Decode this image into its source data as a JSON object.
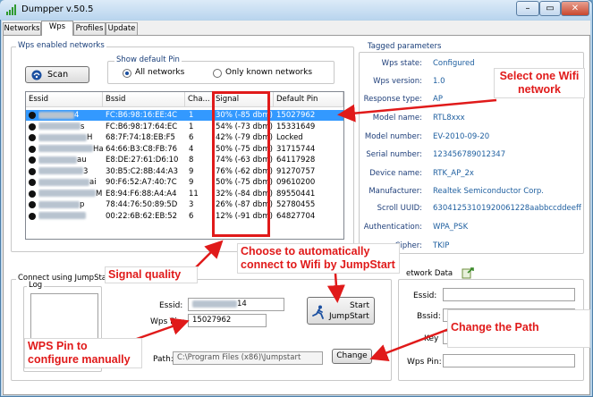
{
  "window": {
    "title": "Dumpper v.50.5",
    "controls": {
      "minimize": "–",
      "maximize": "▭",
      "close": "✕"
    }
  },
  "tabs": [
    {
      "label": "Networks"
    },
    {
      "label": "Wps"
    },
    {
      "label": "Profiles"
    },
    {
      "label": "Update"
    }
  ],
  "wps_networks": {
    "group_title": "Wps enabled networks",
    "scan_label": "Scan",
    "default_pin": {
      "title": "Show default Pin",
      "all_label": "All networks",
      "known_label": "Only known networks",
      "selected": "all"
    },
    "columns": [
      "Essid",
      "Bssid",
      "Cha...",
      "Signal",
      "Default Pin"
    ],
    "rows": [
      {
        "essid": "4",
        "bssid": "FC:B6:98:16:EE:4C",
        "channel": "1",
        "signal": "30% (-85 dbm)",
        "pin": "15027962",
        "selected": true
      },
      {
        "essid": "s",
        "bssid": "FC:B6:98:17:64:EC",
        "channel": "1",
        "signal": "54% (-73 dbm)",
        "pin": "15331649"
      },
      {
        "essid": "H",
        "bssid": "68:7F:74:18:EB:F5",
        "channel": "6",
        "signal": "42% (-79 dbm)",
        "pin": "Locked"
      },
      {
        "essid": "Ha",
        "bssid": "64:66:B3:C8:FB:76",
        "channel": "4",
        "signal": "50% (-75 dbm)",
        "pin": "31715744"
      },
      {
        "essid": "au",
        "bssid": "E8:DE:27:61:D6:10",
        "channel": "8",
        "signal": "74% (-63 dbm)",
        "pin": "64117928"
      },
      {
        "essid": "3",
        "bssid": "30:B5:C2:8B:44:A3",
        "channel": "9",
        "signal": "76% (-62 dbm)",
        "pin": "91270757"
      },
      {
        "essid": "ai",
        "bssid": "90:F6:52:A7:40:7C",
        "channel": "9",
        "signal": "50% (-75 dbm)",
        "pin": "09610200"
      },
      {
        "essid": "M",
        "bssid": "E8:94:F6:88:A4:A4",
        "channel": "11",
        "signal": "32% (-84 dbm)",
        "pin": "89550441"
      },
      {
        "essid": "p",
        "bssid": "78:44:76:50:89:5D",
        "channel": "3",
        "signal": "26% (-87 dbm)",
        "pin": "52780455"
      },
      {
        "essid": "",
        "bssid": "00:22:6B:62:EB:52",
        "channel": "6",
        "signal": "12% (-91 dbm)",
        "pin": "64827704"
      }
    ]
  },
  "tagged": {
    "title": "Tagged parameters",
    "items": [
      {
        "label": "Wps state:",
        "value": "Configured"
      },
      {
        "label": "Wps version:",
        "value": "1.0"
      },
      {
        "label": "Response type:",
        "value": "AP"
      },
      {
        "label": "Model name:",
        "value": "RTL8xxx"
      },
      {
        "label": "Model number:",
        "value": "EV-2010-09-20"
      },
      {
        "label": "Serial number:",
        "value": "123456789012347"
      },
      {
        "label": "Device name:",
        "value": "RTK_AP_2x"
      },
      {
        "label": "Manufacturer:",
        "value": "Realtek Semiconductor Corp."
      },
      {
        "label": "Scroll UUID:",
        "value": "63041253101920061228aabbccddeeff"
      },
      {
        "label": "Authentication:",
        "value": "WPA_PSK"
      },
      {
        "label": "Cipher:",
        "value": "TKIP"
      }
    ]
  },
  "jumpstart": {
    "title": "Connect using JumpStart",
    "log_label": "Log",
    "essid_label": "Essid:",
    "essid_value": "14",
    "wps_pin_label": "Wps Pin:",
    "wps_pin_value": "15027962",
    "path_label": "Path:",
    "path_value": "C:\\Program Files (x86)\\Jumpstart",
    "start_label_1": "Start",
    "start_label_2": "JumpStart",
    "change_label": "Change"
  },
  "network_data": {
    "title": "etwork Data",
    "essid_label": "Essid:",
    "bssid_label": "Bssid:",
    "key_label": "Key",
    "wps_pin_label": "Wps Pin:"
  },
  "annotations": {
    "select_wifi": "Select one Wifi network",
    "signal_quality": "Signal quality",
    "auto_connect": "Choose to automatically connect to Wifi by JumpStart",
    "change_path": "Change the Path",
    "wps_pin_manual": "WPS Pin to configure manually"
  },
  "colors": {
    "annotation_red": "#e01a1a",
    "selection_blue": "#3399ff",
    "tagged_value": "#2060a0"
  }
}
